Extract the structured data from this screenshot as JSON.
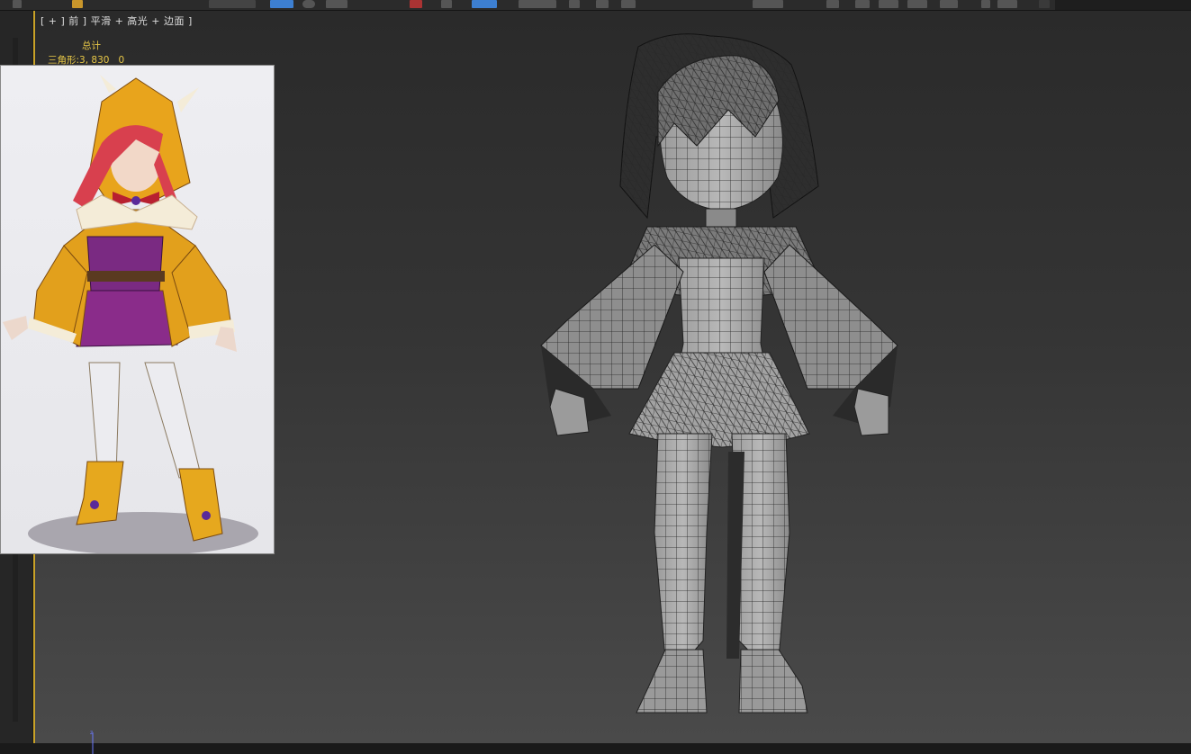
{
  "toolbar": {
    "colors": {
      "background": "#2b2b2b",
      "active": "#3d7fd1"
    },
    "icons": [
      "select-object-icon",
      "rotate-icon",
      "viewport-layout-icon",
      "snaps-icon",
      "curve-editor-icon",
      "render-setup-icon",
      "render-icon"
    ]
  },
  "viewport": {
    "label": "[ + ] 前 ] 平滑 + 高光 + 边面 ]",
    "border_color": "#c9a227",
    "stats": {
      "title": "总计",
      "label": "三角形:",
      "total": "3, 830",
      "selected": "0"
    }
  },
  "reference_image": {
    "description_icon": "character-concept-art-image"
  },
  "model": {
    "icon": "wireframe-character-mesh"
  }
}
